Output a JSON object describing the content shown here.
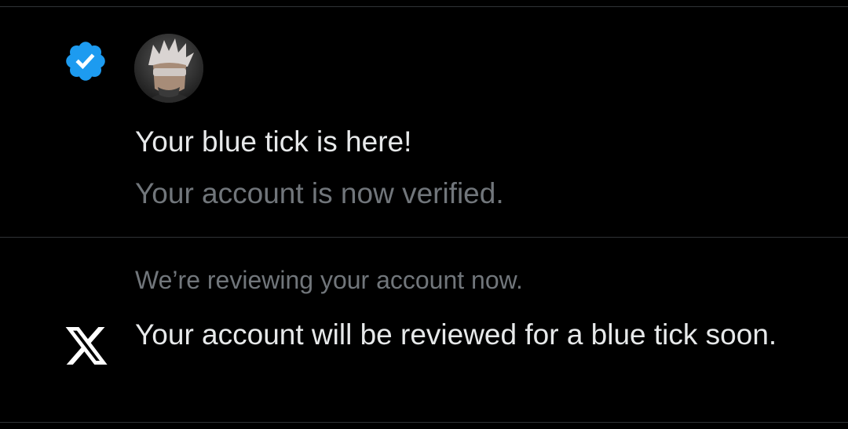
{
  "notifications": [
    {
      "title": "Your blue tick is here!",
      "subtitle": "Your account is now verified.",
      "icon": "verified-badge-icon",
      "badge_color": "#1d9bf0"
    },
    {
      "heading": "We’re reviewing your account now.",
      "body": "Your account will be reviewed for a blue tick soon.",
      "icon": "x-logo-icon"
    }
  ],
  "colors": {
    "background": "#000000",
    "primary_text": "#e7e9ea",
    "secondary_text": "#71767b",
    "divider": "#2f3336",
    "accent": "#1d9bf0"
  }
}
